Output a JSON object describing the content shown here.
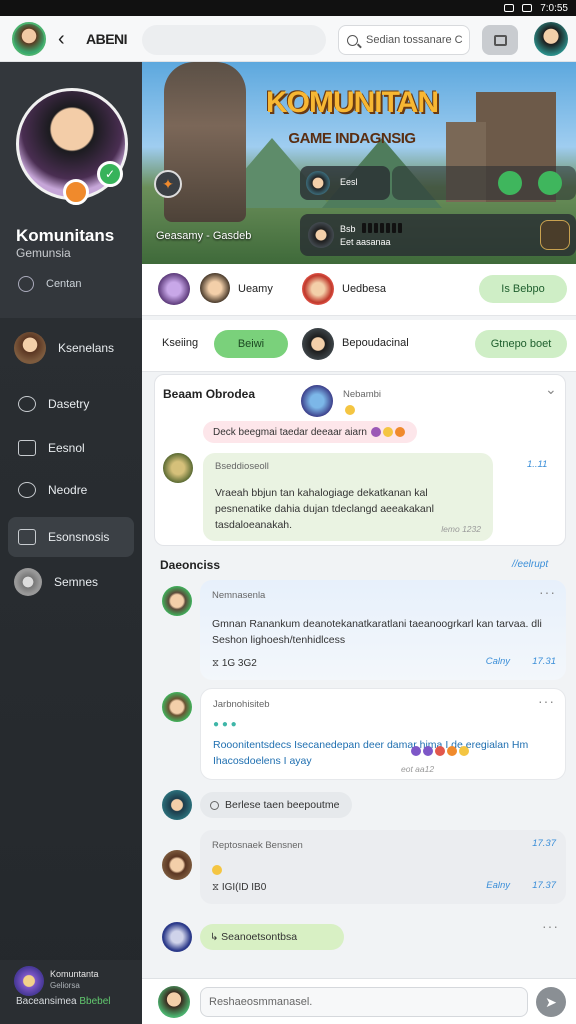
{
  "status": {
    "time": "7:0:55"
  },
  "topbar": {
    "title": "ABENI",
    "search_placeholder": "Sedian tossanare C"
  },
  "sidebar": {
    "profile_name": "Komunitans",
    "profile_sub": "Gemunsia",
    "stat_label": "Centan",
    "items": [
      {
        "label": "Ksenelans"
      },
      {
        "label": "Dasetry"
      },
      {
        "label": "Eesnol"
      },
      {
        "label": "Neodre"
      },
      {
        "label": "Esonsnosis"
      },
      {
        "label": "Semnes"
      }
    ],
    "bottom": {
      "line1": "Komuntanta",
      "line2": "Geliorsa",
      "line3": "Baceansimea",
      "line3_accent": "Bbebel"
    }
  },
  "banner": {
    "title": "KOMUNITAN",
    "subtitle": "GAME INDAGNSIG",
    "caption": "Geasamy - Gasdeb",
    "ov1_text": "Eesl",
    "ov2_line1": "Bsb",
    "ov2_line2": "Eet aasanaa"
  },
  "strips": {
    "members": [
      {
        "label": "Ueamy"
      },
      {
        "label": "Uedbesa"
      }
    ],
    "members_button": "Is Bebpo",
    "tabs": {
      "left": "Kseiing",
      "active": "Beiwi",
      "person": "Bepoudacinal",
      "right": "Gtnepo boet"
    }
  },
  "feed": {
    "section1": {
      "title": "Beaam Obrodea",
      "poster": "Nebambi",
      "tag": "Deck beegmai taedar deeaar aiarn",
      "post_sender": "Bseddioseoll",
      "post_text": "Vraeah bbjun tan kahalogiage dekatkanan kal pesnenatike dahia dujan tdeclangd aeeakakanl tasdaloeanakah.",
      "post_meta": "lemo 1232",
      "post_time": "1..11"
    },
    "section2_title": "Daeonciss",
    "section2_link": "//eelrupt",
    "messages": [
      {
        "sender": "Nemnasenla",
        "text": "Gmnan Ranankum deanotekanatkaratlani taeanoogrkarl kan tarvaa. dli Seshon lighoesh/tenhidlcess",
        "stat": "1G 3G2",
        "meta": "Calny",
        "time": "17.31"
      },
      {
        "sender": "Jarbnohisiteb",
        "text": "Rooonitentsdecs Isecanedepan deer damar hima I de eregialan Hm Ihacosdoelens I ayay",
        "time": "eot aa12"
      },
      {
        "sender": "",
        "text": "Berlese taen beepoutme"
      },
      {
        "sender": "Reptosnaek Bensnen",
        "stat": "IGI(ID IB0",
        "meta": "Ealny",
        "time": "17.37",
        "time_top": "17.37"
      },
      {
        "text": "Seanoetsontbsa"
      }
    ]
  },
  "composer": {
    "placeholder": "Reshaeosmmanasel."
  },
  "colors": {
    "accent_green": "#7ad17b",
    "sidebar_bg": "#2c3034",
    "link_blue": "#3a8ed8"
  }
}
